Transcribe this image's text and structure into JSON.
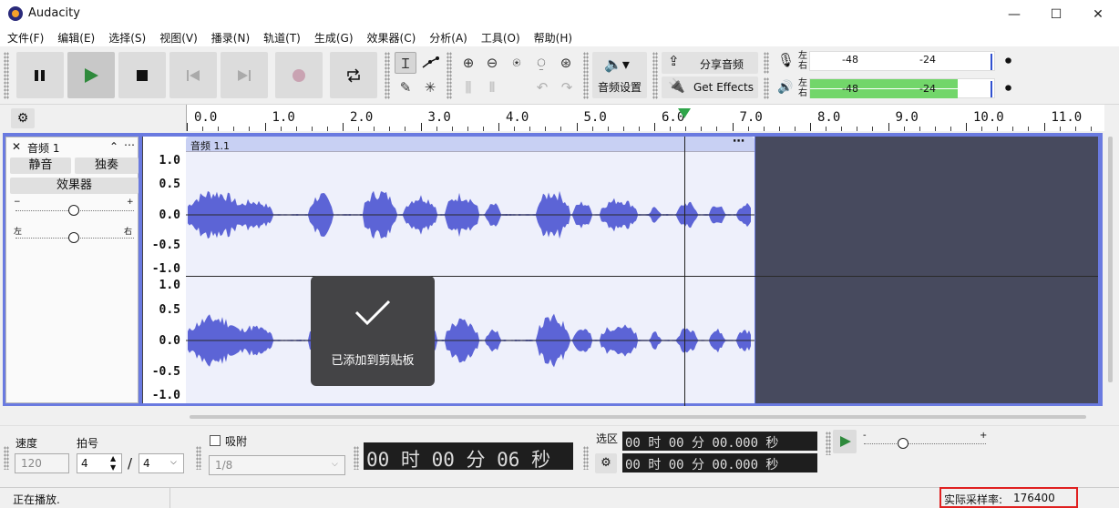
{
  "window": {
    "title": "Audacity",
    "minimize": "—",
    "maximize": "☐",
    "close": "✕"
  },
  "menu": [
    "文件(F)",
    "编辑(E)",
    "选择(S)",
    "视图(V)",
    "播录(N)",
    "轨道(T)",
    "生成(G)",
    "效果器(C)",
    "分析(A)",
    "工具(O)",
    "帮助(H)"
  ],
  "toolbar": {
    "audio_setup": "音频设置",
    "share_audio": "分享音频",
    "get_effects": "Get Effects",
    "record_meter": {
      "left": "左",
      "right": "右",
      "tick1": "-48",
      "tick2": "-24"
    },
    "play_meter": {
      "left": "左",
      "right": "右",
      "tick1": "-48",
      "tick2": "-24"
    }
  },
  "ruler": {
    "labels": [
      "0.0",
      "1.0",
      "2.0",
      "3.0",
      "4.0",
      "5.0",
      "6.0",
      "7.0",
      "8.0",
      "9.0",
      "10.0",
      "11.0"
    ]
  },
  "track": {
    "name": "音频 1",
    "mute": "静音",
    "solo": "独奏",
    "effects": "效果器",
    "gain_minus": "−",
    "gain_plus": "+",
    "pan_left": "左",
    "pan_right": "右",
    "clip_name": "音频 1.1",
    "scale_top": [
      "1.0",
      "0.5",
      "0.0",
      "-0.5",
      "-1.0"
    ],
    "scale_bottom": [
      "1.0",
      "0.5",
      "0.0",
      "-0.5",
      "-1.0"
    ]
  },
  "toast": {
    "message": "已添加到剪贴板"
  },
  "bottom": {
    "tempo_label": "速度",
    "tempo_value": "120",
    "timesig_label": "拍号",
    "timesig_num": "4",
    "timesig_sep": "/",
    "timesig_den": "4",
    "snap_label": "吸附",
    "snap_value": "1/8",
    "time_display": "00 时 00 分 06 秒",
    "selection_label": "选区",
    "sel_start": "00 时 00 分 00.000 秒",
    "sel_end": "00 时 00 分 00.000 秒",
    "speed_minus": "-",
    "speed_plus": "+"
  },
  "status": {
    "text": "正在播放.",
    "rate_label": "实际采样率:",
    "rate_value": "176400"
  },
  "colors": {
    "waveform": "#5c64d6",
    "clip_bg": "#eef0fb",
    "empty_track": "#474a5e",
    "track_border": "#6a7ae0",
    "status_highlight": "#e02020"
  }
}
